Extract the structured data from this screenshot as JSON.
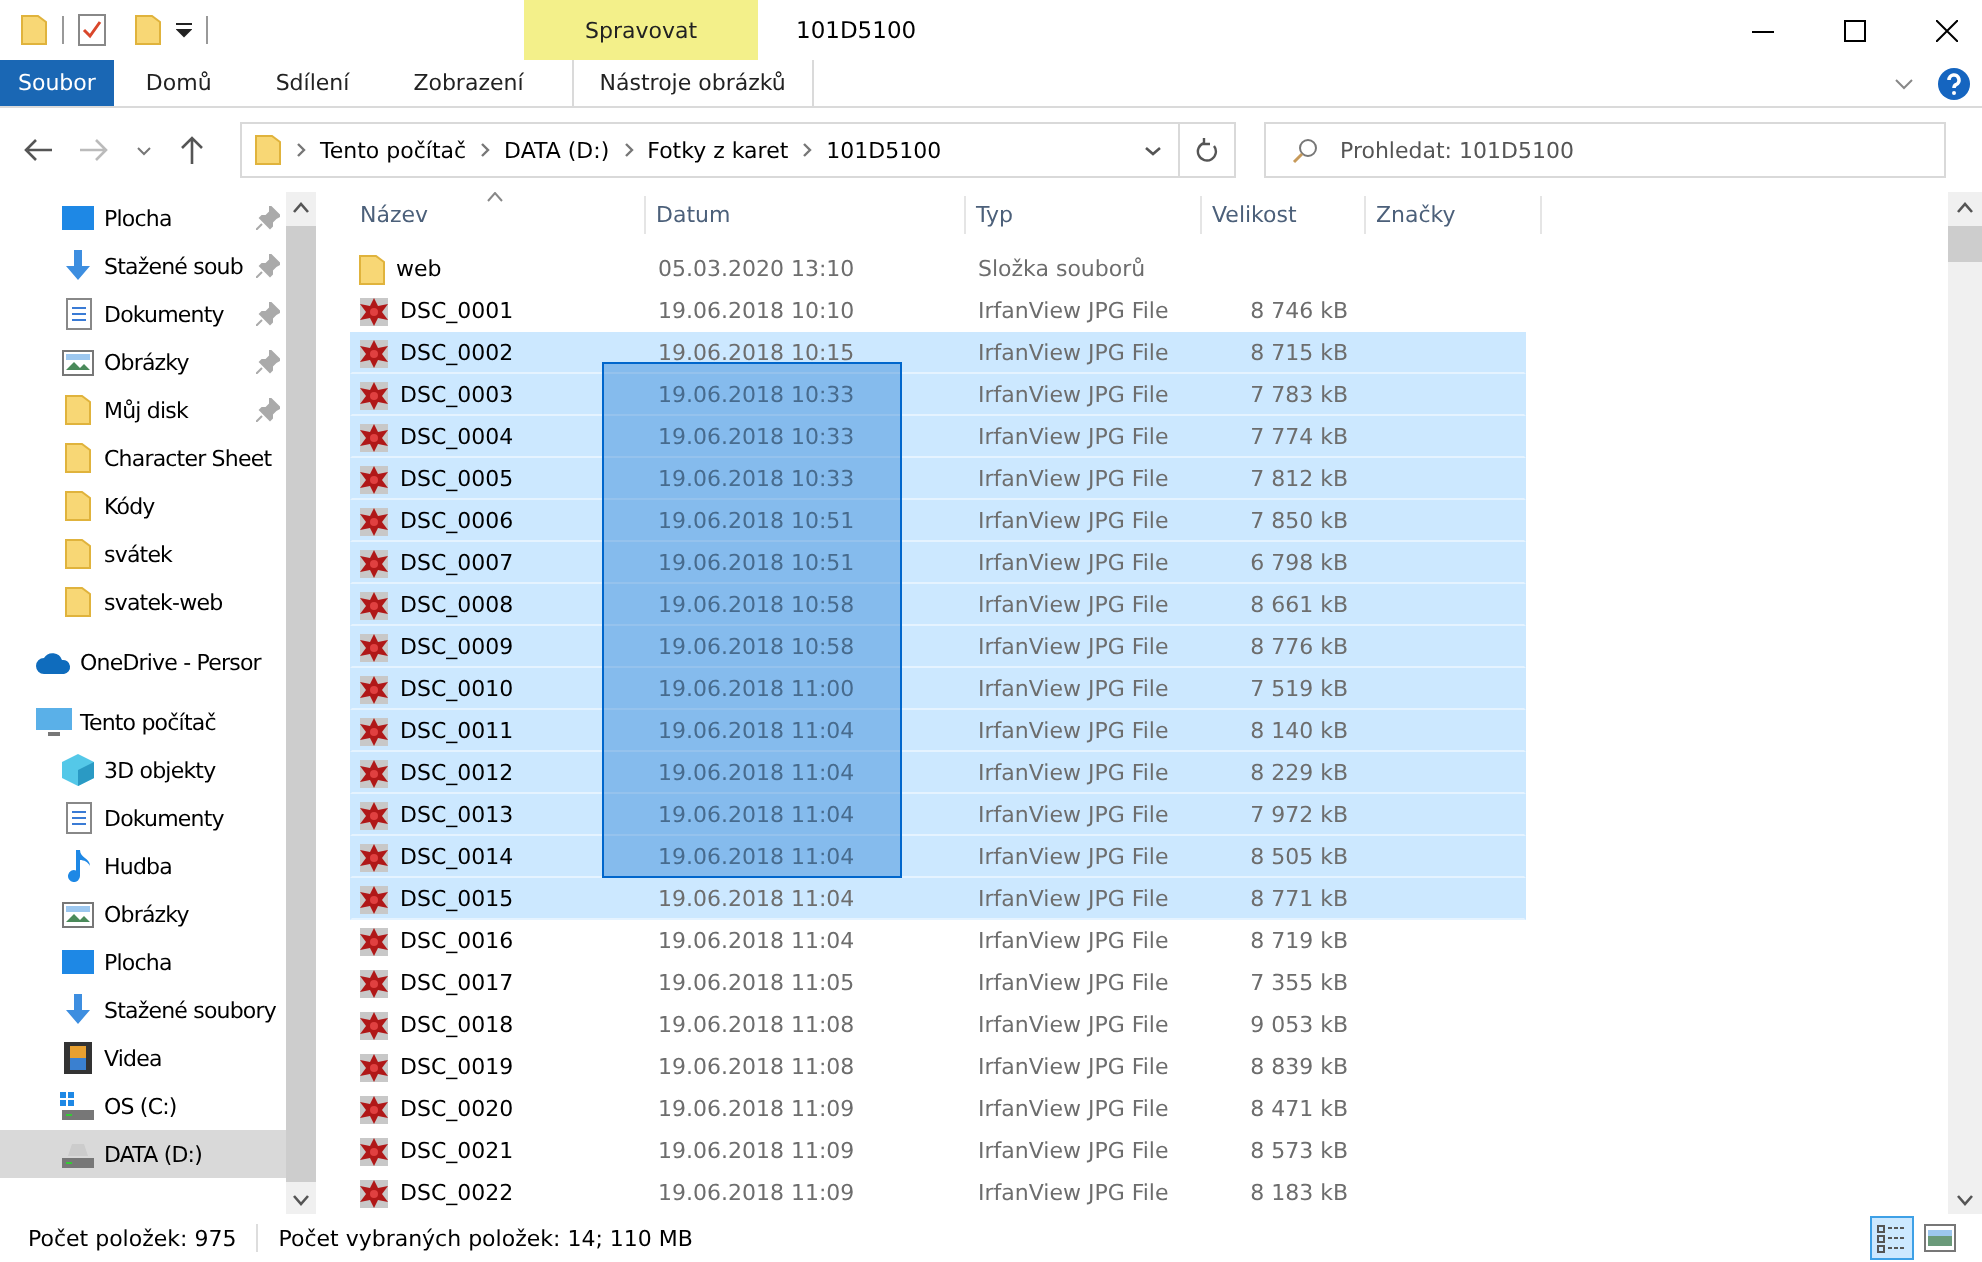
{
  "window": {
    "title": "101D5100",
    "context_tab": "Spravovat"
  },
  "ribbon_tabs": [
    {
      "label": "Soubor",
      "kind": "file",
      "selected": false
    },
    {
      "label": "Domů",
      "kind": "tab",
      "selected": false
    },
    {
      "label": "Sdílení",
      "kind": "tab",
      "selected": false
    },
    {
      "label": "Zobrazení",
      "kind": "tab",
      "selected": false
    },
    {
      "label": "Nástroje obrázků",
      "kind": "context",
      "selected": false
    }
  ],
  "breadcrumb": [
    "Tento počítač",
    "DATA (D:)",
    "Fotky z karet",
    "101D5100"
  ],
  "search": {
    "placeholder": "Prohledat: 101D5100"
  },
  "sidebar": {
    "items": [
      {
        "label": "Plocha",
        "kind": "desktop",
        "pinned": true,
        "selected": false
      },
      {
        "label": "Stažené soub",
        "kind": "download",
        "pinned": true,
        "selected": false
      },
      {
        "label": "Dokumenty",
        "kind": "document",
        "pinned": true,
        "selected": false
      },
      {
        "label": "Obrázky",
        "kind": "pictures",
        "pinned": true,
        "selected": false
      },
      {
        "label": "Můj disk",
        "kind": "folder",
        "pinned": true,
        "selected": false
      },
      {
        "label": "Character Sheet",
        "kind": "folder",
        "pinned": false,
        "selected": false
      },
      {
        "label": "Kódy",
        "kind": "folder",
        "pinned": false,
        "selected": false
      },
      {
        "label": "svátek",
        "kind": "folder",
        "pinned": false,
        "selected": false
      },
      {
        "label": "svatek-web",
        "kind": "folder",
        "pinned": false,
        "selected": false
      },
      {
        "label": "OneDrive - Persor",
        "kind": "onedrive",
        "pinned": false,
        "selected": false
      },
      {
        "label": "Tento počítač",
        "kind": "pc",
        "pinned": false,
        "selected": false
      },
      {
        "label": "3D objekty",
        "kind": "cube",
        "pinned": false,
        "selected": false
      },
      {
        "label": "Dokumenty",
        "kind": "document",
        "pinned": false,
        "selected": false
      },
      {
        "label": "Hudba",
        "kind": "music",
        "pinned": false,
        "selected": false
      },
      {
        "label": "Obrázky",
        "kind": "pictures",
        "pinned": false,
        "selected": false
      },
      {
        "label": "Plocha",
        "kind": "desktop",
        "pinned": false,
        "selected": false
      },
      {
        "label": "Stažené soubory",
        "kind": "download",
        "pinned": false,
        "selected": false
      },
      {
        "label": "Videa",
        "kind": "video",
        "pinned": false,
        "selected": false
      },
      {
        "label": "OS (C:)",
        "kind": "osdrive",
        "pinned": false,
        "selected": false
      },
      {
        "label": "DATA (D:)",
        "kind": "drive",
        "pinned": false,
        "selected": true
      }
    ]
  },
  "table": {
    "columns": [
      "Název",
      "Datum",
      "Typ",
      "Velikost",
      "Značky"
    ],
    "rows": [
      {
        "name": "web",
        "date": "05.03.2020 13:10",
        "type": "Složka souborů",
        "kind": "folder",
        "selected": false
      },
      {
        "name": "DSC_0001",
        "date": "19.06.2018 10:10",
        "type": "IrfanView JPG File",
        "size": "8 746 kB",
        "kind": "image",
        "selected": false
      },
      {
        "name": "DSC_0002",
        "date": "19.06.2018 10:15",
        "type": "IrfanView JPG File",
        "size": "8 715 kB",
        "kind": "image",
        "selected": true
      },
      {
        "name": "DSC_0003",
        "date": "19.06.2018 10:33",
        "type": "IrfanView JPG File",
        "size": "7 783 kB",
        "kind": "image",
        "selected": true
      },
      {
        "name": "DSC_0004",
        "date": "19.06.2018 10:33",
        "type": "IrfanView JPG File",
        "size": "7 774 kB",
        "kind": "image",
        "selected": true
      },
      {
        "name": "DSC_0005",
        "date": "19.06.2018 10:33",
        "type": "IrfanView JPG File",
        "size": "7 812 kB",
        "kind": "image",
        "selected": true
      },
      {
        "name": "DSC_0006",
        "date": "19.06.2018 10:51",
        "type": "IrfanView JPG File",
        "size": "7 850 kB",
        "kind": "image",
        "selected": true
      },
      {
        "name": "DSC_0007",
        "date": "19.06.2018 10:51",
        "type": "IrfanView JPG File",
        "size": "6 798 kB",
        "kind": "image",
        "selected": true
      },
      {
        "name": "DSC_0008",
        "date": "19.06.2018 10:58",
        "type": "IrfanView JPG File",
        "size": "8 661 kB",
        "kind": "image",
        "selected": true
      },
      {
        "name": "DSC_0009",
        "date": "19.06.2018 10:58",
        "type": "IrfanView JPG File",
        "size": "8 776 kB",
        "kind": "image",
        "selected": true
      },
      {
        "name": "DSC_0010",
        "date": "19.06.2018 11:00",
        "type": "IrfanView JPG File",
        "size": "7 519 kB",
        "kind": "image",
        "selected": true
      },
      {
        "name": "DSC_0011",
        "date": "19.06.2018 11:04",
        "type": "IrfanView JPG File",
        "size": "8 140 kB",
        "kind": "image",
        "selected": true
      },
      {
        "name": "DSC_0012",
        "date": "19.06.2018 11:04",
        "type": "IrfanView JPG File",
        "size": "8 229 kB",
        "kind": "image",
        "selected": true
      },
      {
        "name": "DSC_0013",
        "date": "19.06.2018 11:04",
        "type": "IrfanView JPG File",
        "size": "7 972 kB",
        "kind": "image",
        "selected": true
      },
      {
        "name": "DSC_0014",
        "date": "19.06.2018 11:04",
        "type": "IrfanView JPG File",
        "size": "8 505 kB",
        "kind": "image",
        "selected": true
      },
      {
        "name": "DSC_0015",
        "date": "19.06.2018 11:04",
        "type": "IrfanView JPG File",
        "size": "8 771 kB",
        "kind": "image",
        "selected": true
      },
      {
        "name": "DSC_0016",
        "date": "19.06.2018 11:04",
        "type": "IrfanView JPG File",
        "size": "8 719 kB",
        "kind": "image",
        "selected": false
      },
      {
        "name": "DSC_0017",
        "date": "19.06.2018 11:05",
        "type": "IrfanView JPG File",
        "size": "7 355 kB",
        "kind": "image",
        "selected": false
      },
      {
        "name": "DSC_0018",
        "date": "19.06.2018 11:08",
        "type": "IrfanView JPG File",
        "size": "9 053 kB",
        "kind": "image",
        "selected": false
      },
      {
        "name": "DSC_0019",
        "date": "19.06.2018 11:08",
        "type": "IrfanView JPG File",
        "size": "8 839 kB",
        "kind": "image",
        "selected": false
      },
      {
        "name": "DSC_0020",
        "date": "19.06.2018 11:09",
        "type": "IrfanView JPG File",
        "size": "8 471 kB",
        "kind": "image",
        "selected": false
      },
      {
        "name": "DSC_0021",
        "date": "19.06.2018 11:09",
        "type": "IrfanView JPG File",
        "size": "8 573 kB",
        "kind": "image",
        "selected": false
      },
      {
        "name": "DSC_0022",
        "date": "19.06.2018 11:09",
        "type": "IrfanView JPG File",
        "size": "8 183 kB",
        "kind": "image",
        "selected": false
      }
    ]
  },
  "status_bar": {
    "item_count": "Počet položek: 975",
    "selection": "Počet vybraných položek: 14; 110 MB"
  },
  "views": [
    {
      "kind": "details",
      "selected": true
    },
    {
      "kind": "thumbnails",
      "selected": false
    }
  ]
}
